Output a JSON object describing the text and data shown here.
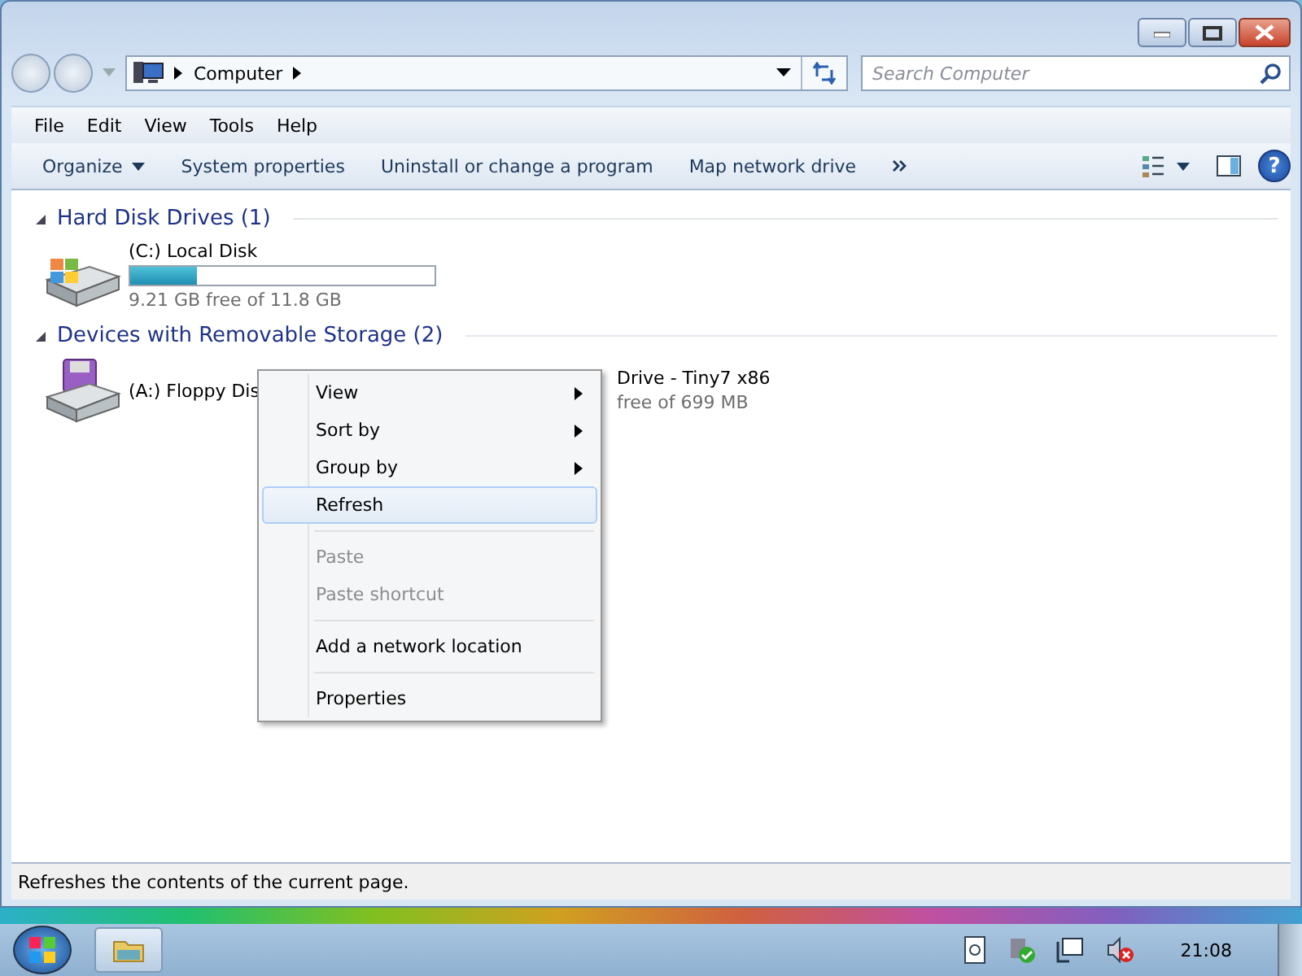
{
  "address_bar": {
    "location": "Computer",
    "search_placeholder": "Search Computer"
  },
  "menu_bar": [
    "File",
    "Edit",
    "View",
    "Tools",
    "Help"
  ],
  "command_bar": [
    "Organize",
    "System properties",
    "Uninstall or change a program",
    "Map network drive"
  ],
  "groups": [
    {
      "title": "Hard Disk Drives (1)",
      "expanded": true,
      "drives": [
        {
          "kind": "hdd",
          "name": "(C:) Local Disk",
          "level": 0.22,
          "free": "9.21 GB free of 11.8 GB"
        }
      ]
    },
    {
      "title": "Devices with Removable Storage (2)",
      "expanded": true,
      "drives": [
        {
          "kind": "floppy",
          "name": "(A:) Floppy Dis"
        },
        {
          "kind": "optical",
          "name": "Drive - Tiny7 x86",
          "free": "free of 699 MB"
        }
      ]
    }
  ],
  "context_menu": [
    {
      "kind": "item",
      "label": "View",
      "submenu": true,
      "disabled": false,
      "selected": false
    },
    {
      "kind": "item",
      "label": "Sort by",
      "submenu": true,
      "disabled": false,
      "selected": false
    },
    {
      "kind": "item",
      "label": "Group by",
      "submenu": true,
      "disabled": false,
      "selected": false
    },
    {
      "kind": "item",
      "label": "Refresh",
      "submenu": false,
      "disabled": false,
      "selected": true
    },
    {
      "kind": "separator"
    },
    {
      "kind": "item",
      "label": "Paste",
      "submenu": false,
      "disabled": true,
      "selected": false
    },
    {
      "kind": "item",
      "label": "Paste shortcut",
      "submenu": false,
      "disabled": true,
      "selected": false
    },
    {
      "kind": "separator"
    },
    {
      "kind": "item",
      "label": "Add a network location",
      "submenu": false,
      "disabled": false,
      "selected": false
    },
    {
      "kind": "separator"
    },
    {
      "kind": "item",
      "label": "Properties",
      "submenu": false,
      "disabled": false,
      "selected": false
    }
  ],
  "status_bar": "Refreshes the contents of the current page.",
  "help_glyph": "?",
  "taskbar": {
    "clock": "21:08"
  }
}
